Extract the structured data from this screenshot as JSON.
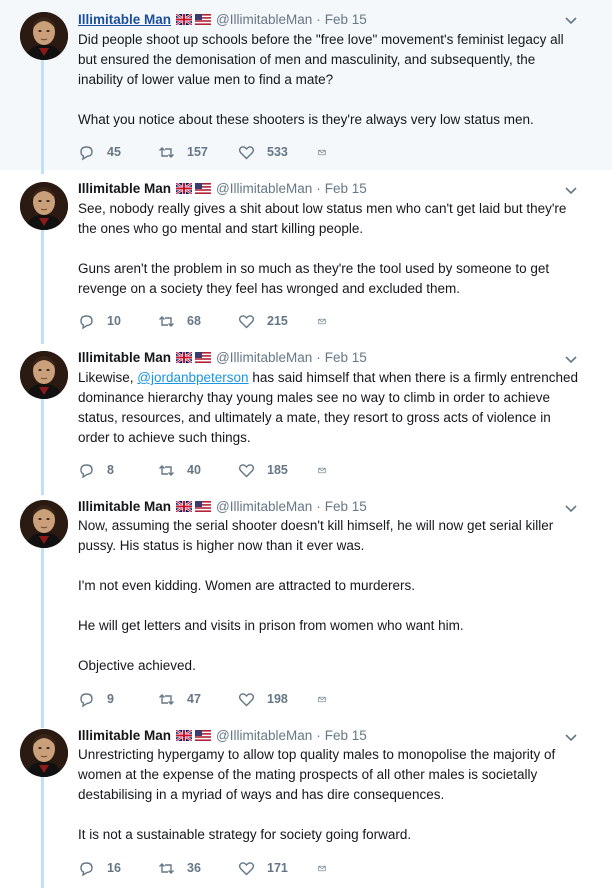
{
  "colors": {
    "thread_line": "#bfe0f5",
    "handle_gray": "#657786",
    "link_blue": "#1b95e0",
    "highlight_bg": "#f5f8fa"
  },
  "tweets": [
    {
      "name": "Illimitable Man",
      "handle": "@IllimitableMan",
      "dot": "·",
      "date": "Feb 15",
      "paragraphs": [
        [
          "Did people shoot up schools before the \"free love\" movement's feminist legacy all but ensured the demonisation of men and masculinity, and subsequently, the inability of lower value men to find a mate?"
        ],
        [
          "What you notice about these shooters is they're always very low status men."
        ]
      ],
      "replies": "45",
      "retweets": "157",
      "likes": "533"
    },
    {
      "name": "Illimitable Man",
      "handle": "@IllimitableMan",
      "dot": "·",
      "date": "Feb 15",
      "paragraphs": [
        [
          "See, nobody really gives a shit about low status men who can't get laid but they're the ones who go mental and start killing people."
        ],
        [
          "Guns aren't the problem in so much as they're the tool used by someone to get revenge on a society they feel has wronged and excluded them."
        ]
      ],
      "replies": "10",
      "retweets": "68",
      "likes": "215"
    },
    {
      "name": "Illimitable Man",
      "handle": "@IllimitableMan",
      "dot": "·",
      "date": "Feb 15",
      "paragraphs": [
        [
          "Likewise, ",
          "@jordanbpeterson",
          " has said himself that when there is a firmly entrenched dominance hierarchy thay young males see no way to climb in order to achieve status, resources, and ultimately a mate, they resort to gross acts of violence in order to achieve such things."
        ]
      ],
      "replies": "8",
      "retweets": "40",
      "likes": "185"
    },
    {
      "name": "Illimitable Man",
      "handle": "@IllimitableMan",
      "dot": "·",
      "date": "Feb 15",
      "paragraphs": [
        [
          "Now, assuming the serial shooter doesn't kill himself, he will now get serial killer pussy. His status is higher now than it ever was."
        ],
        [
          "I'm not even kidding. Women are attracted to murderers."
        ],
        [
          "He will get letters and visits in prison from women who want him."
        ],
        [
          "Objective achieved."
        ]
      ],
      "replies": "9",
      "retweets": "47",
      "likes": "198"
    },
    {
      "name": "Illimitable Man",
      "handle": "@IllimitableMan",
      "dot": "·",
      "date": "Feb 15",
      "paragraphs": [
        [
          "Unrestricting hypergamy to allow top quality males to monopolise the majority of women at the expense of the mating prospects of all other males is societally destabilising in a myriad of ways and has dire consequences."
        ],
        [
          "It is not a sustainable strategy for society going forward."
        ]
      ],
      "replies": "16",
      "retweets": "36",
      "likes": "171"
    }
  ]
}
